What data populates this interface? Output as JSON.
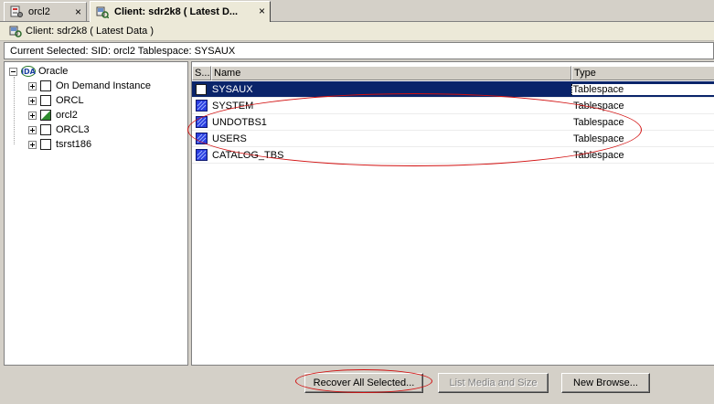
{
  "tabs": [
    {
      "label": "orcl2",
      "close": "×",
      "icon": "database-config-icon"
    },
    {
      "label": "Client: sdr2k8 ( Latest D...",
      "close": "×",
      "icon": "client-browse-icon"
    }
  ],
  "client_bar": {
    "label": "Client: sdr2k8 ( Latest Data )",
    "icon": "client-icon"
  },
  "current_selected": "Current Selected: SID: orcl2  Tablespace: SYSAUX",
  "tree": {
    "root": {
      "label": "Oracle",
      "icon": "oracle-ida-icon"
    },
    "items": [
      {
        "label": "On Demand Instance",
        "state": "unchecked"
      },
      {
        "label": "ORCL",
        "state": "unchecked"
      },
      {
        "label": "orcl2",
        "state": "partial"
      },
      {
        "label": "ORCL3",
        "state": "unchecked"
      },
      {
        "label": "tsrst186",
        "state": "unchecked"
      }
    ]
  },
  "list": {
    "columns": {
      "select": "S...",
      "name": "Name",
      "type": "Type"
    },
    "rows": [
      {
        "name": "SYSAUX",
        "type": "Tablespace",
        "selected": true,
        "checked": false
      },
      {
        "name": "SYSTEM",
        "type": "Tablespace",
        "selected": false,
        "checked": true
      },
      {
        "name": "UNDOTBS1",
        "type": "Tablespace",
        "selected": false,
        "checked": true
      },
      {
        "name": "USERS",
        "type": "Tablespace",
        "selected": false,
        "checked": true
      },
      {
        "name": "CATALOG_TBS",
        "type": "Tablespace",
        "selected": false,
        "checked": true
      }
    ]
  },
  "buttons": {
    "recover": "Recover All Selected...",
    "list_media": "List Media and Size",
    "new_browse": "New Browse..."
  },
  "colors": {
    "selection": "#0a246a",
    "annotation": "#d21010",
    "partial_check": "#2e8b2e"
  }
}
